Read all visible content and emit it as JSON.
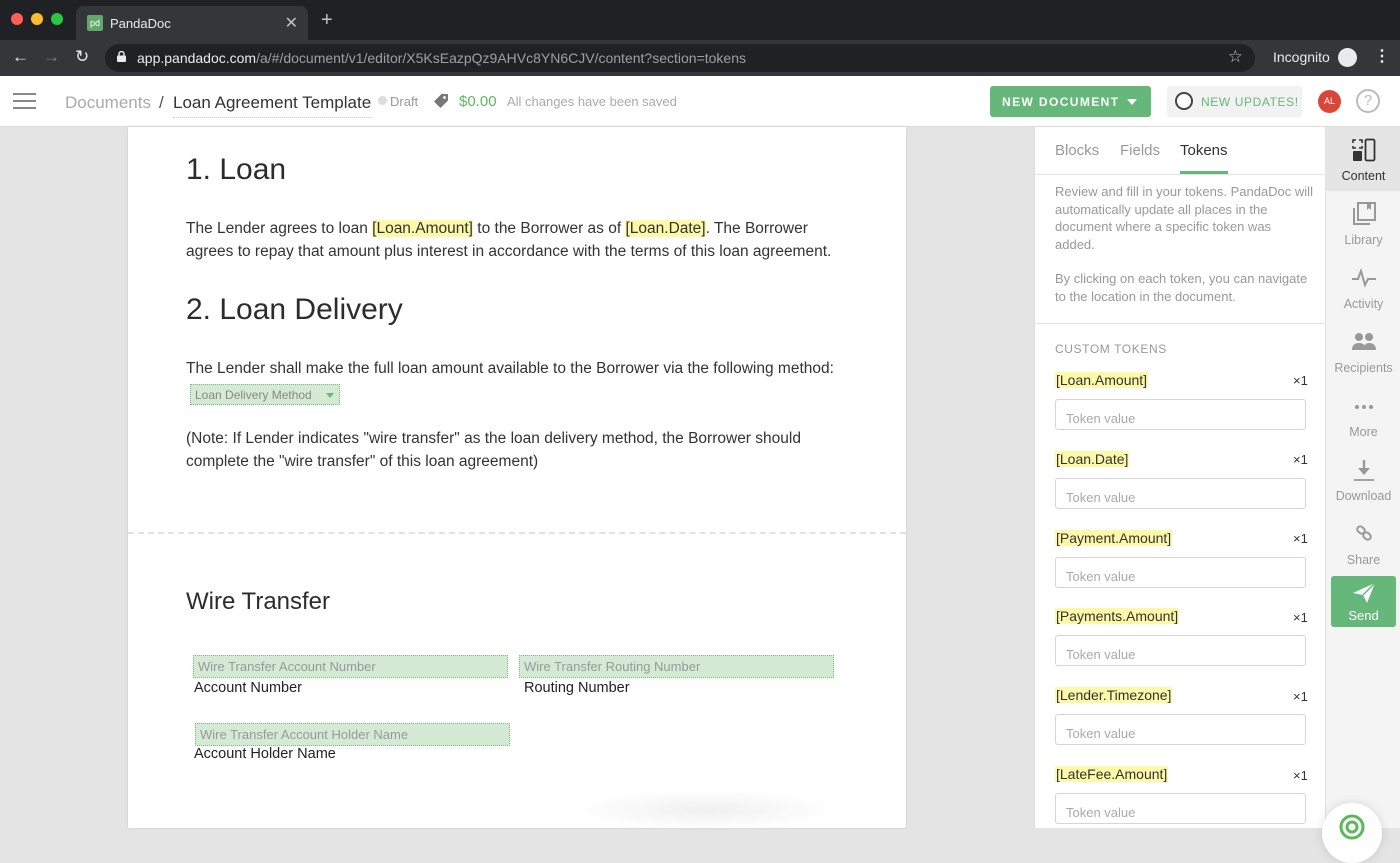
{
  "browser": {
    "tab_title": "PandaDoc",
    "favicon_text": "pd",
    "url_host": "app.pandadoc.com",
    "url_path": "/a/#/document/v1/editor/X5KsEazpQz9AHVc8YN6CJV/content?section=tokens",
    "incognito_label": "Incognito"
  },
  "header": {
    "breadcrumb_root": "Documents",
    "breadcrumb_sep": "/",
    "doc_title": "Loan Agreement Template",
    "status": "Draft",
    "price": "$0.00",
    "save_status": "All changes have been saved",
    "new_document_label": "NEW DOCUMENT",
    "new_updates_label": "NEW UPDATES!",
    "avatar_initials": "AL",
    "help_label": "?"
  },
  "document": {
    "section1_title": "1. Loan",
    "section1_text": {
      "a": "The Lender agrees to loan ",
      "token1": "[Loan.Amount]",
      "b": " to the Borrower as of ",
      "token2": "[Loan.Date]",
      "c": ". The Borrower agrees to repay that amount plus interest in accordance with the terms of this loan agreement."
    },
    "section2_title": "2. Loan Delivery",
    "section2_text": "The Lender shall make the full loan amount available to the Borrower via the following method:",
    "delivery_dropdown": "Loan Delivery Method",
    "note_text": "(Note: If Lender indicates \"wire transfer\" as the loan delivery method, the Borrower should complete the \"wire transfer\" of this loan agreement)",
    "wire_title": "Wire Transfer",
    "fields": [
      {
        "placeholder": "Wire Transfer Account Number",
        "label": "Account Number"
      },
      {
        "placeholder": "Wire Transfer Routing Number",
        "label": "Routing Number"
      },
      {
        "placeholder": "Wire Transfer Account Holder Name",
        "label": "Account Holder Name"
      }
    ]
  },
  "panel": {
    "tabs": [
      {
        "label": "Blocks"
      },
      {
        "label": "Fields"
      },
      {
        "label": "Tokens",
        "active": true
      }
    ],
    "desc1": "Review and fill in your tokens. PandaDoc will automatically update all places in the document where a specific token was added.",
    "desc2": "By clicking on each token, you can navigate to the location in the document.",
    "custom_tokens_title": "CUSTOM TOKENS",
    "tokens": [
      {
        "name": "[Loan.Amount]",
        "count": "×1",
        "placeholder": "Token value"
      },
      {
        "name": "[Loan.Date]",
        "count": "×1",
        "placeholder": "Token value"
      },
      {
        "name": "[Payment.Amount]",
        "count": "×1",
        "placeholder": "Token value"
      },
      {
        "name": "[Payments.Amount]",
        "count": "×1",
        "placeholder": "Token value"
      },
      {
        "name": "[Lender.Timezone]",
        "count": "×1",
        "placeholder": "Token value"
      },
      {
        "name": "[LateFee.Amount]",
        "count": "×1",
        "placeholder": "Token value"
      }
    ]
  },
  "rail": {
    "items": [
      {
        "label": "Content",
        "icon": "content-icon",
        "active": true
      },
      {
        "label": "Library",
        "icon": "library-icon"
      },
      {
        "label": "Activity",
        "icon": "activity-icon"
      },
      {
        "label": "Recipients",
        "icon": "recipients-icon"
      },
      {
        "label": "More",
        "icon": "more-icon"
      },
      {
        "label": "Download",
        "icon": "download-icon"
      },
      {
        "label": "Share",
        "icon": "share-icon"
      }
    ],
    "send_label": "Send"
  },
  "colors": {
    "brand_green": "#66b77a",
    "token_highlight": "#fdf9a8",
    "field_fill": "#d4ead5",
    "avatar_red": "#d9473b"
  }
}
